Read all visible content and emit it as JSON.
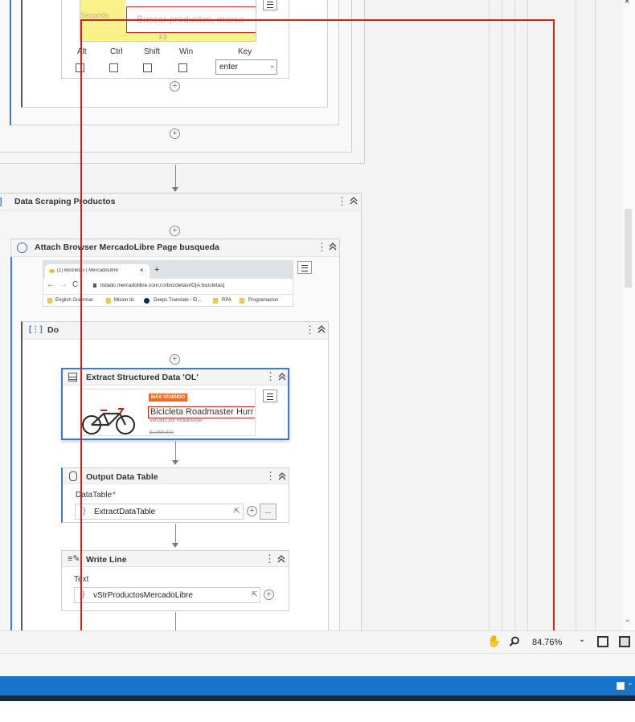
{
  "screenshot": {
    "keyboard": {
      "labels": [
        "Alt",
        "Ctrl",
        "Shift",
        "Win",
        "Key"
      ],
      "key_value": "enter",
      "thumb_text": "Buscar productos, marca",
      "seconds_text": "Seconds",
      "f_key": "F3"
    },
    "data_scraping": {
      "title": "Data Scraping Productos"
    },
    "attach_browser": {
      "title": "Attach Browser MercadoLibre Page busqueda",
      "tab_title": "(1) Bicicletas | MercadoLibre",
      "url": "listado.mercadolibre.com.co/bicicletas#D[A:bicicletas]",
      "bookmarks": [
        "English Grammar",
        "Mision tic",
        "DeepL Translate - El...",
        "RPA",
        "Programacion"
      ]
    },
    "do_block": {
      "title": "Do"
    },
    "extract": {
      "title": "Extract Structured Data 'OL'",
      "badge": "MÁS VENDIDO",
      "product": "Bicicleta Roadmaster Hurr",
      "seller": "Vendido por Roadmaster",
      "price": "$1.899.900"
    },
    "output_table": {
      "title": "Output Data Table",
      "field_label": "DataTable",
      "required_mark": "*",
      "value": "ExtractDataTable",
      "more": "..."
    },
    "write_line": {
      "title": "Write Line",
      "field_label": "Text",
      "value": "vStrProductosMercadoLibre"
    },
    "status": {
      "zoom": "84.76%"
    }
  }
}
